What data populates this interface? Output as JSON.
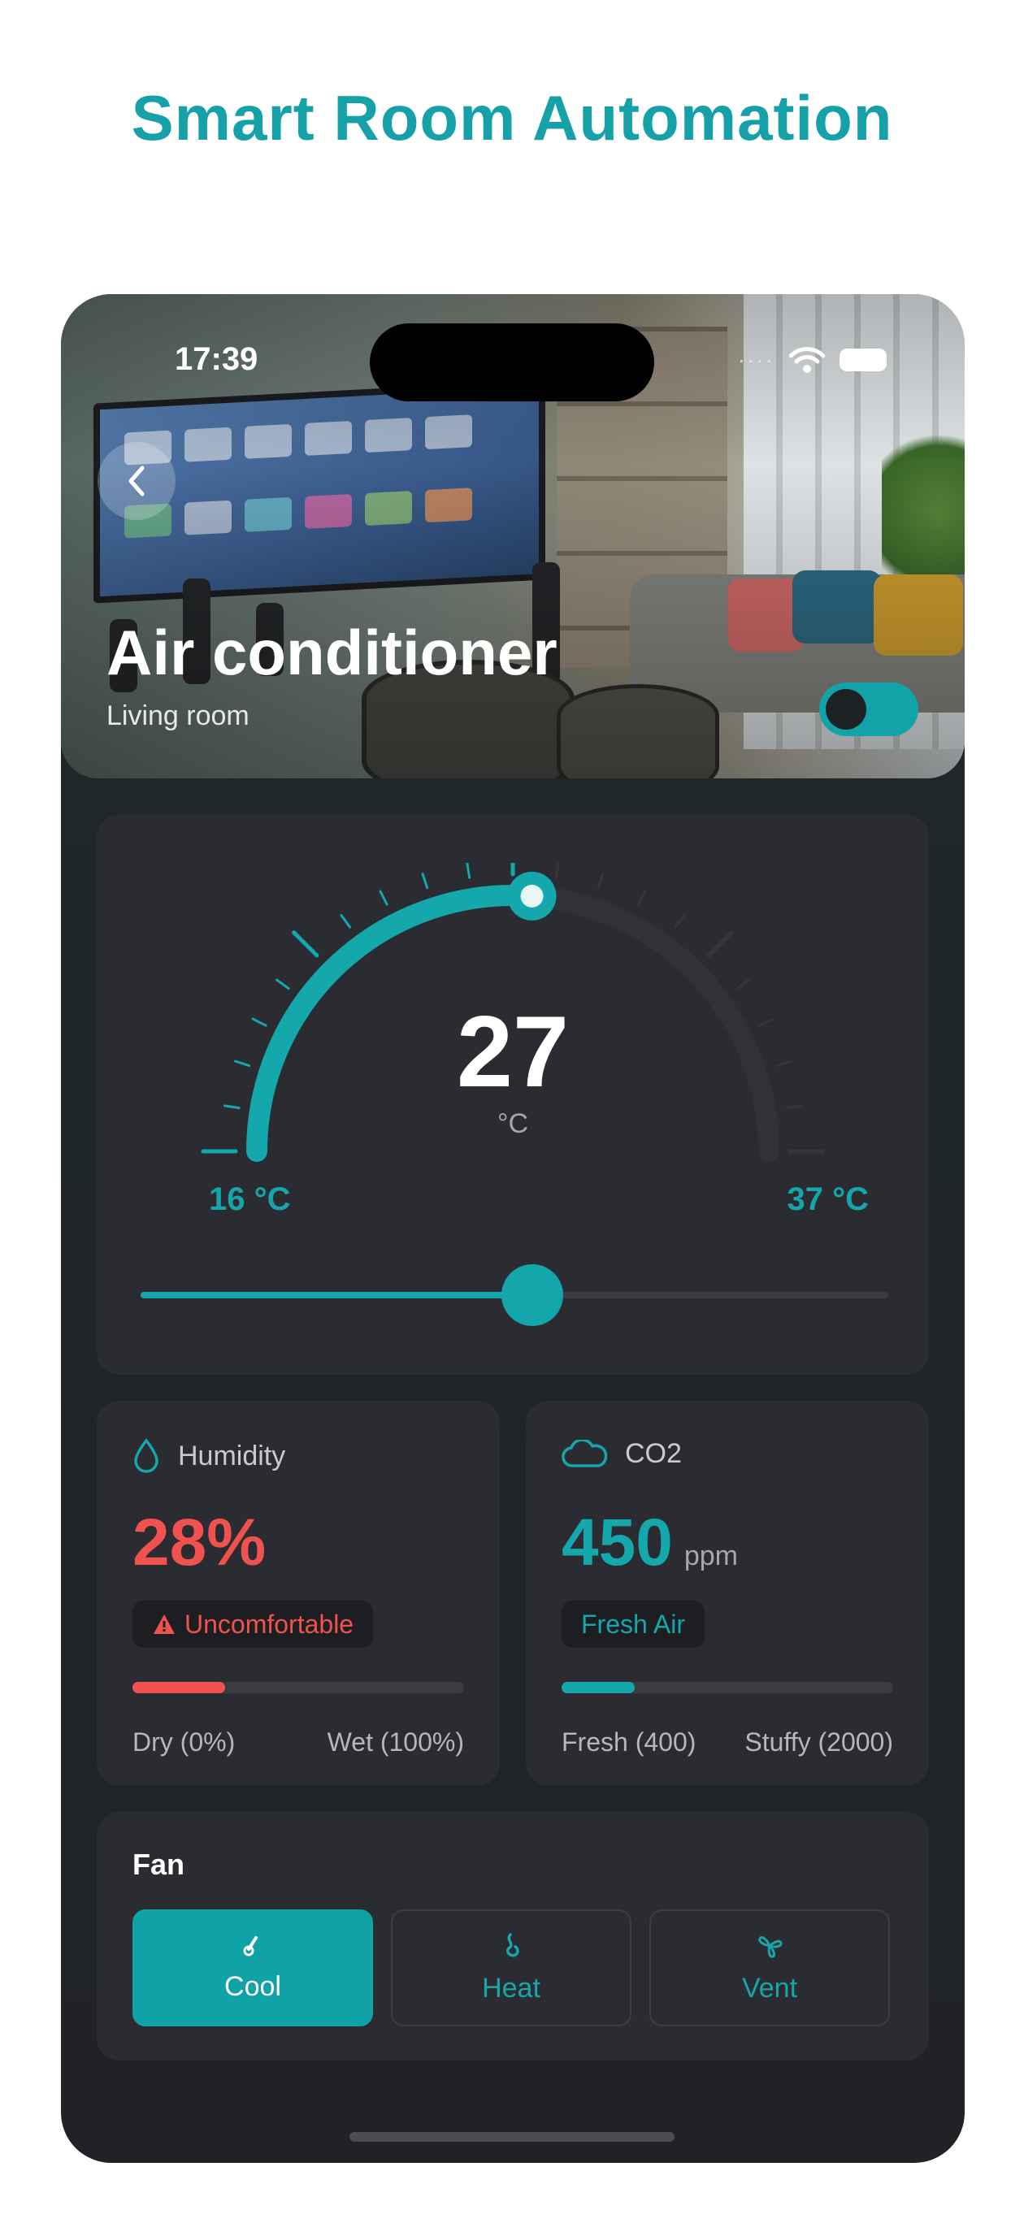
{
  "page": {
    "title": "Smart Room Automation"
  },
  "status_bar": {
    "time": "17:39"
  },
  "device": {
    "name": "Air conditioner",
    "room": "Living room",
    "power_on": true
  },
  "temperature": {
    "value": "27",
    "unit": "°C",
    "min_label": "16  °C",
    "max_label": "37 °C",
    "min": 16,
    "max": 37,
    "current": 27
  },
  "humidity": {
    "label": "Humidity",
    "value": "28%",
    "status": "Uncomfortable",
    "level": 0.28,
    "range_low": "Dry (0%)",
    "range_high": "Wet (100%)",
    "color": "#f0524f"
  },
  "co2": {
    "label": "CO2",
    "value": "450",
    "unit": "ppm",
    "status": "Fresh Air",
    "level": 0.22,
    "range_low": "Fresh (400)",
    "range_high": "Stuffy (2000)",
    "color": "#14a7ab"
  },
  "fan": {
    "title": "Fan",
    "modes": [
      {
        "label": "Cool",
        "icon": "thermometer-icon",
        "active": true
      },
      {
        "label": "Heat",
        "icon": "flame-icon",
        "active": false
      },
      {
        "label": "Vent",
        "icon": "fan-icon",
        "active": false
      }
    ]
  },
  "colors": {
    "accent": "#14a7ab",
    "warning": "#f0524f",
    "title": "#16a0a8"
  }
}
